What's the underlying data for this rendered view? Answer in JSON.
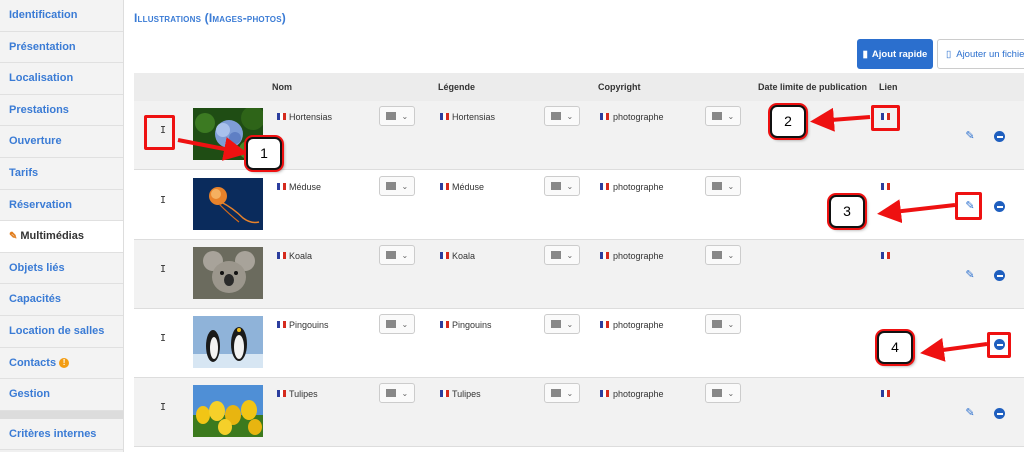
{
  "sidebar": {
    "items": [
      {
        "label": "Identification"
      },
      {
        "label": "Présentation"
      },
      {
        "label": "Localisation"
      },
      {
        "label": "Prestations"
      },
      {
        "label": "Ouverture"
      },
      {
        "label": "Tarifs"
      },
      {
        "label": "Réservation"
      },
      {
        "label": "Multimédias"
      },
      {
        "label": "Objets liés"
      },
      {
        "label": "Capacités"
      },
      {
        "label": "Location de salles"
      },
      {
        "label": "Contacts"
      },
      {
        "label": "Gestion"
      }
    ],
    "bottom_item": "Critères internes"
  },
  "main": {
    "title": "Illustrations (Images-photos)",
    "btn_quick": "Ajout rapide",
    "btn_file": "Ajouter un fichier",
    "columns": [
      "Nom",
      "Légende",
      "Copyright",
      "Date limite de publication",
      "Lien"
    ],
    "rows": [
      {
        "name": "Hortensias",
        "legend": "Hortensias",
        "copyright": "photographe",
        "thumb": "hydrangea"
      },
      {
        "name": "Méduse",
        "legend": "Méduse",
        "copyright": "photographe",
        "thumb": "jellyfish"
      },
      {
        "name": "Koala",
        "legend": "Koala",
        "copyright": "photographe",
        "thumb": "koala"
      },
      {
        "name": "Pingouins",
        "legend": "Pingouins",
        "copyright": "photographe",
        "thumb": "penguins"
      },
      {
        "name": "Tulipes",
        "legend": "Tulipes",
        "copyright": "photographe",
        "thumb": "tulips"
      }
    ]
  },
  "annotations": [
    "1",
    "2",
    "3",
    "4"
  ],
  "colors": {
    "accent": "#3a7bd5",
    "button": "#2b6fce",
    "annotation": "#e11111"
  }
}
